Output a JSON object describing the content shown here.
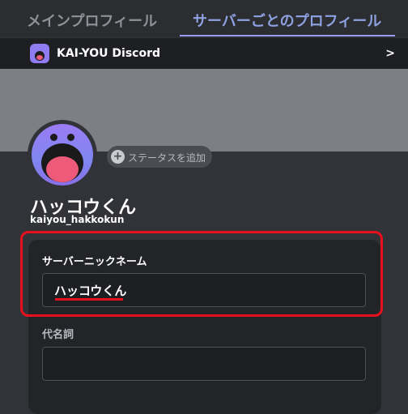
{
  "tabs": {
    "main_profile": "メインプロフィール",
    "server_profile": "サーバーごとのプロフィール"
  },
  "server": {
    "name": "KAI-YOU Discord",
    "arrow": ">"
  },
  "profile": {
    "status_button": "ステータスを追加",
    "status_plus": "+",
    "display_name": "ハッコウくん",
    "username": "kaiyou_hakkokun"
  },
  "form": {
    "nickname_label": "サーバーニックネーム",
    "nickname_value": "ハッコウくん",
    "pronouns_label": "代名詞",
    "pronouns_value": ""
  },
  "colors": {
    "accent_tab": "#949cf7",
    "highlight_red": "#e8101d",
    "avatar_purple": "#9b7cf6",
    "background": "#313338"
  }
}
